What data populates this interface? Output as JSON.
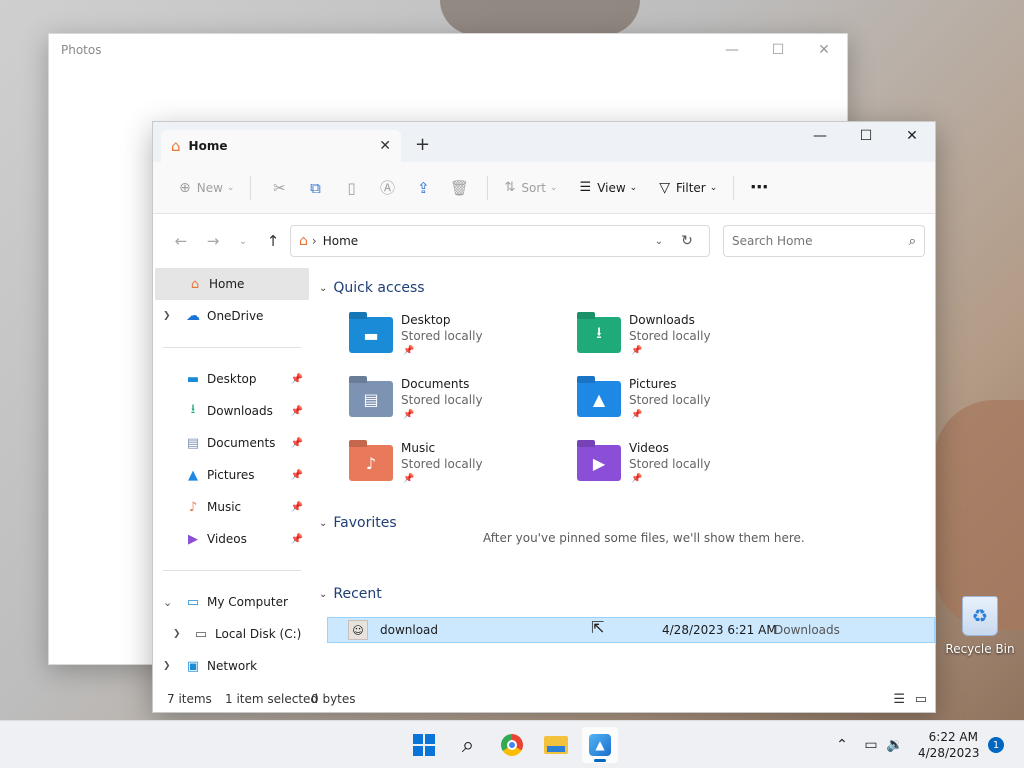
{
  "photos_window": {
    "title": "Photos",
    "minimize": "—",
    "maximize": "☐",
    "close": "✕"
  },
  "explorer": {
    "tab_title": "Home",
    "tab_close": "✕",
    "new_tab": "+",
    "window_controls": {
      "minimize": "—",
      "maximize": "☐",
      "close": "✕"
    },
    "toolbar": {
      "new_label": "New",
      "sort_label": "Sort",
      "view_label": "View",
      "filter_label": "Filter",
      "more": "⋯"
    },
    "address": {
      "breadcrumb": "Home",
      "separator": "›"
    },
    "search": {
      "placeholder": "Search Home"
    },
    "sidebar": {
      "home": "Home",
      "onedrive": "OneDrive",
      "pinned": [
        {
          "label": "Desktop",
          "icon": "desktop-icon"
        },
        {
          "label": "Downloads",
          "icon": "download-icon"
        },
        {
          "label": "Documents",
          "icon": "document-icon"
        },
        {
          "label": "Pictures",
          "icon": "pictures-icon"
        },
        {
          "label": "Music",
          "icon": "music-icon"
        },
        {
          "label": "Videos",
          "icon": "video-icon"
        }
      ],
      "my_computer": "My Computer",
      "local_disk": "Local Disk (C:)",
      "network": "Network"
    },
    "quick_access": {
      "header": "Quick access",
      "items": [
        {
          "name": "Desktop",
          "status": "Stored locally",
          "color": "#1a8bd6"
        },
        {
          "name": "Downloads",
          "status": "Stored locally",
          "color": "#1faa7a"
        },
        {
          "name": "Documents",
          "status": "Stored locally",
          "color": "#7d93b3"
        },
        {
          "name": "Pictures",
          "status": "Stored locally",
          "color": "#1e88e5"
        },
        {
          "name": "Music",
          "status": "Stored locally",
          "color": "#e8795a"
        },
        {
          "name": "Videos",
          "status": "Stored locally",
          "color": "#8a4fd6"
        }
      ]
    },
    "favorites": {
      "header": "Favorites",
      "empty_message": "After you've pinned some files, we'll show them here."
    },
    "recent": {
      "header": "Recent",
      "items": [
        {
          "name": "download",
          "date": "4/28/2023 6:21 AM",
          "location": "Downloads"
        }
      ]
    },
    "status": {
      "count": "7 items",
      "selected": "1 item selected",
      "size": "0 bytes"
    }
  },
  "desktop": {
    "recycle_bin": "Recycle Bin"
  },
  "taskbar": {
    "time": "6:22 AM",
    "date": "4/28/2023",
    "notifications": "1"
  }
}
